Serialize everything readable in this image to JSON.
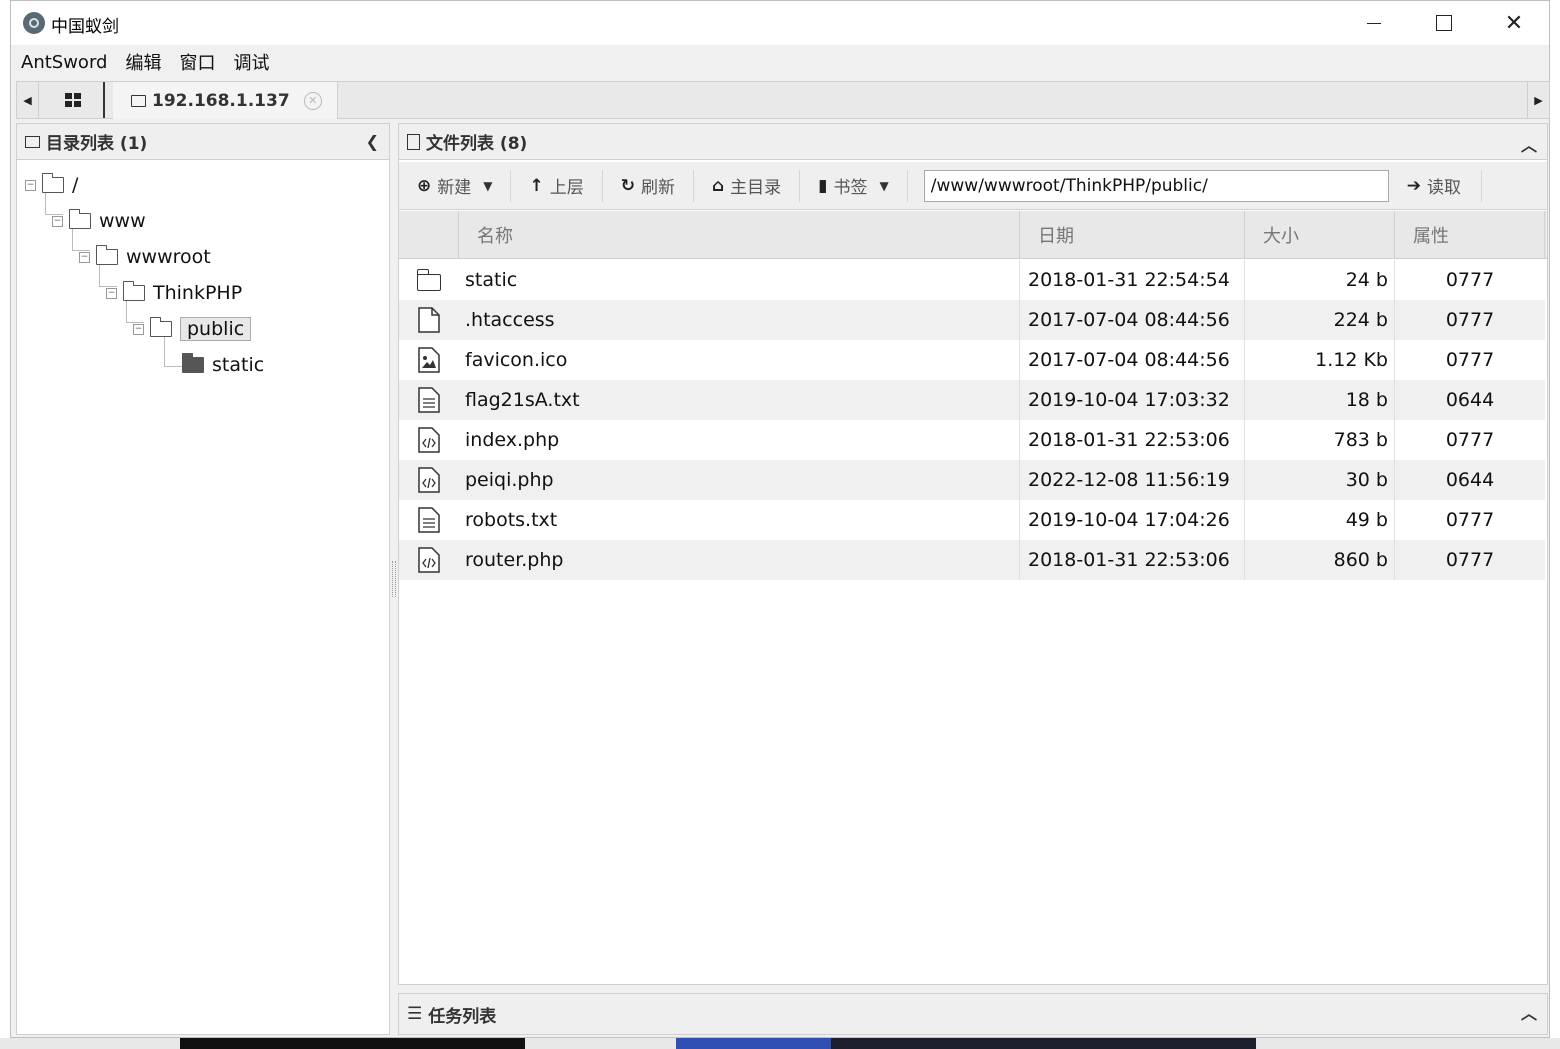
{
  "window": {
    "title": "中国蚁剑",
    "minimize_icon": "minimize-icon",
    "maximize_icon": "maximize-icon",
    "close_icon": "close-icon"
  },
  "menu": [
    "AntSword",
    "编辑",
    "窗口",
    "调试"
  ],
  "tabs": {
    "home_icon": "grid-icon",
    "active_label": "192.168.1.137"
  },
  "directory_panel": {
    "title": "目录列表 (1)",
    "tree": [
      {
        "label": "/",
        "depth": 0,
        "expanded": true
      },
      {
        "label": "www",
        "depth": 1,
        "expanded": true
      },
      {
        "label": "wwwroot",
        "depth": 2,
        "expanded": true
      },
      {
        "label": "ThinkPHP",
        "depth": 3,
        "expanded": true
      },
      {
        "label": "public",
        "depth": 4,
        "expanded": true,
        "selected": true
      },
      {
        "label": "static",
        "depth": 5,
        "expanded": false
      }
    ]
  },
  "file_panel": {
    "title": "文件列表 (8)",
    "toolbar": {
      "new_label": "新建",
      "up_label": "上层",
      "refresh_label": "刷新",
      "home_label": "主目录",
      "bookmark_label": "书签",
      "path_value": "/www/wwwroot/ThinkPHP/public/",
      "read_label": "读取"
    },
    "columns": [
      "名称",
      "日期",
      "大小",
      "属性"
    ],
    "files": [
      {
        "icon": "folder-icon",
        "name": "static",
        "date": "2018-01-31 22:54:54",
        "size": "24 b",
        "attr": "0777"
      },
      {
        "icon": "file-icon",
        "name": ".htaccess",
        "date": "2017-07-04 08:44:56",
        "size": "224 b",
        "attr": "0777"
      },
      {
        "icon": "image-file-icon",
        "name": "favicon.ico",
        "date": "2017-07-04 08:44:56",
        "size": "1.12 Kb",
        "attr": "0777"
      },
      {
        "icon": "text-file-icon",
        "name": "flag21sA.txt",
        "date": "2019-10-04 17:03:32",
        "size": "18 b",
        "attr": "0644"
      },
      {
        "icon": "code-file-icon",
        "name": "index.php",
        "date": "2018-01-31 22:53:06",
        "size": "783 b",
        "attr": "0777"
      },
      {
        "icon": "code-file-icon",
        "name": "peiqi.php",
        "date": "2022-12-08 11:56:19",
        "size": "30 b",
        "attr": "0644"
      },
      {
        "icon": "text-file-icon",
        "name": "robots.txt",
        "date": "2019-10-04 17:04:26",
        "size": "49 b",
        "attr": "0777"
      },
      {
        "icon": "code-file-icon",
        "name": "router.php",
        "date": "2018-01-31 22:53:06",
        "size": "860 b",
        "attr": "0777"
      }
    ]
  },
  "task_panel": {
    "title": "任务列表"
  }
}
